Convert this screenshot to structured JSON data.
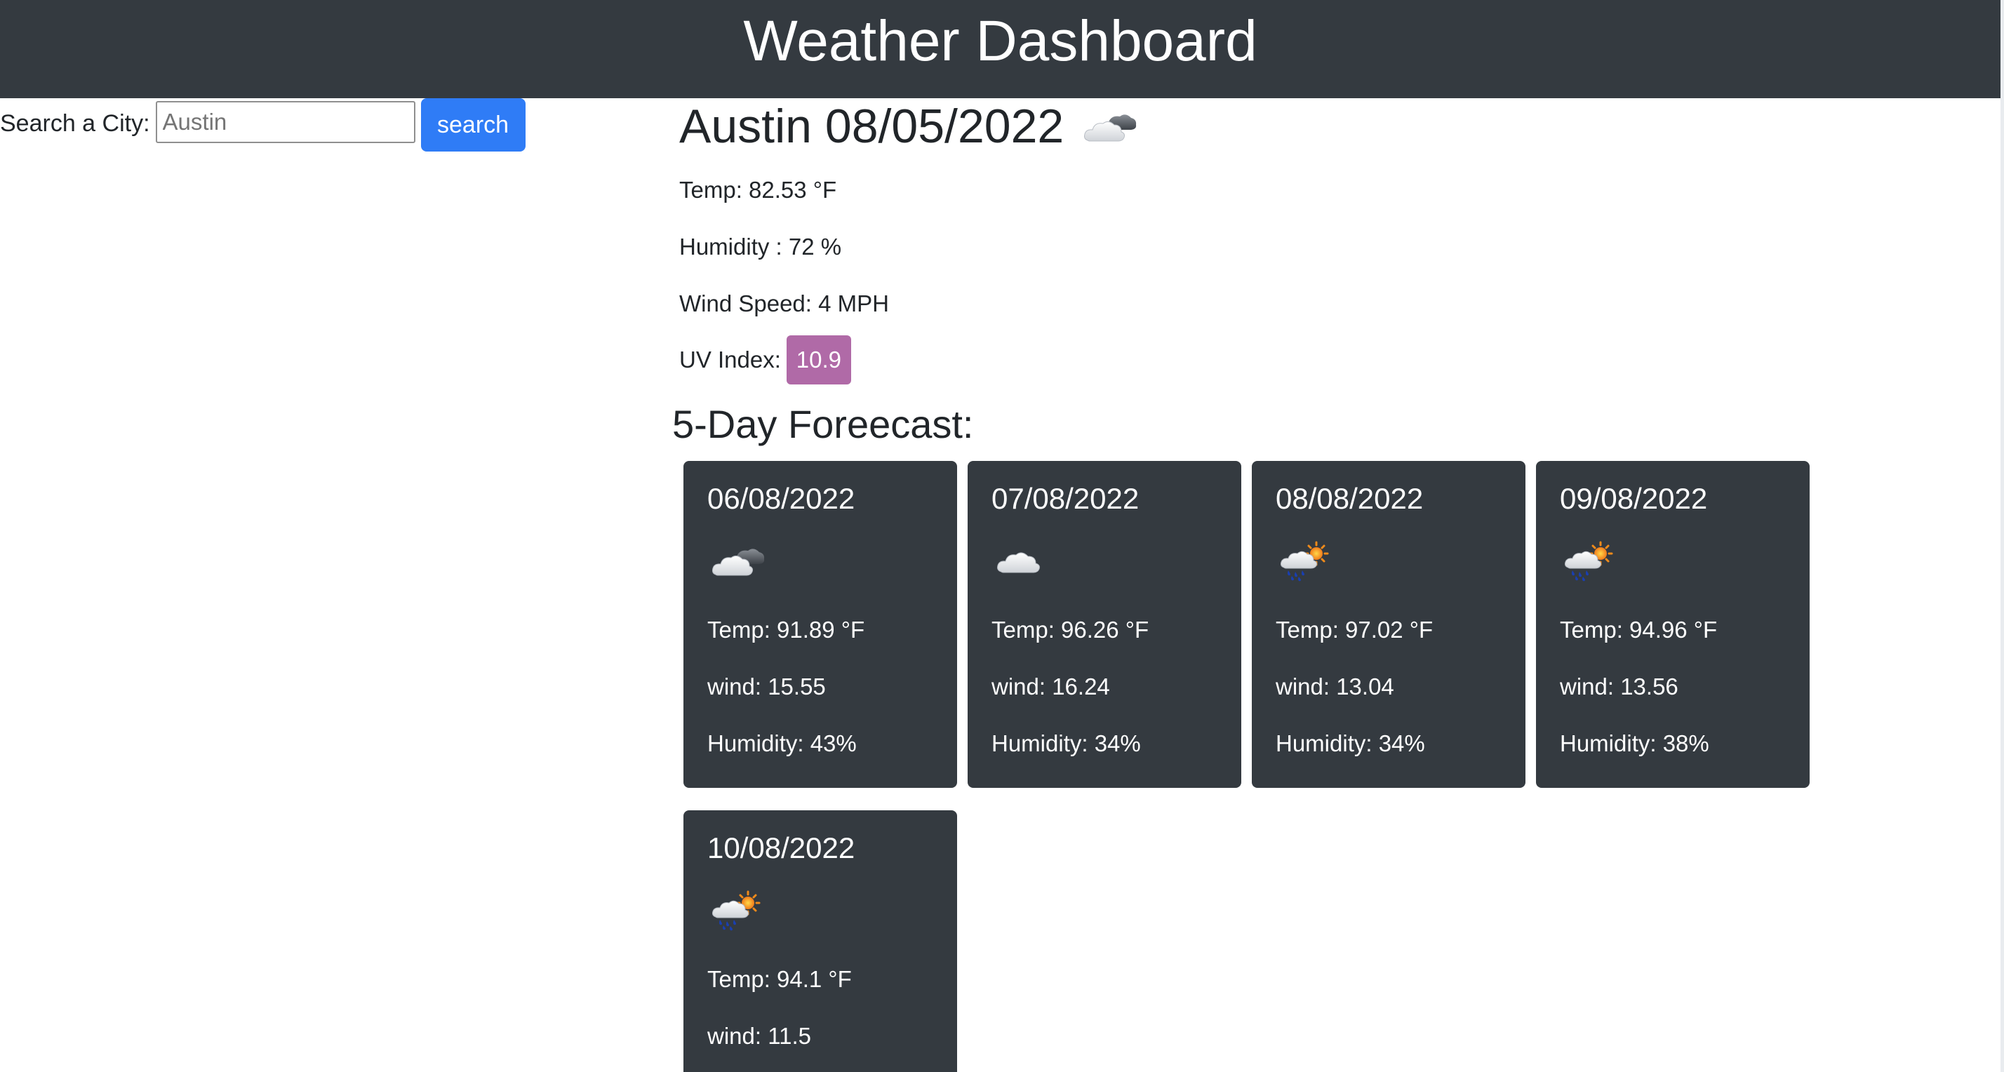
{
  "header": {
    "title": "Weather Dashboard"
  },
  "search": {
    "label": "Search a City:",
    "placeholder": "Austin",
    "value": "",
    "button_label": "search"
  },
  "current": {
    "city_date": "Austin 08/05/2022",
    "icon": "partly-cloudy-icon",
    "temp": "Temp: 82.53 °F",
    "humidity": "Humidity : 72 %",
    "wind": "Wind Speed: 4 MPH",
    "uv_label": "UV Index:",
    "uv_value": "10.9",
    "uv_color": "#b06aa7"
  },
  "forecast": {
    "heading": "5-Day Foreecast:",
    "days": [
      {
        "date": "06/08/2022",
        "icon": "partly-cloudy-icon",
        "temp": "Temp: 91.89 °F",
        "wind": "wind: 15.55",
        "humidity": "Humidity: 43%"
      },
      {
        "date": "07/08/2022",
        "icon": "cloud-icon",
        "temp": "Temp: 96.26 °F",
        "wind": "wind: 16.24",
        "humidity": "Humidity: 34%"
      },
      {
        "date": "08/08/2022",
        "icon": "sun-rain-icon",
        "temp": "Temp: 97.02 °F",
        "wind": "wind: 13.04",
        "humidity": "Humidity: 34%"
      },
      {
        "date": "09/08/2022",
        "icon": "sun-rain-icon",
        "temp": "Temp: 94.96 °F",
        "wind": "wind: 13.56",
        "humidity": "Humidity: 38%"
      },
      {
        "date": "10/08/2022",
        "icon": "sun-rain-icon",
        "temp": "Temp: 94.1 °F",
        "wind": "wind: 11.5",
        "humidity": ""
      }
    ]
  },
  "colors": {
    "header_bg": "#343a40",
    "card_bg": "#343a40",
    "button_bg": "#2f7cf6"
  }
}
